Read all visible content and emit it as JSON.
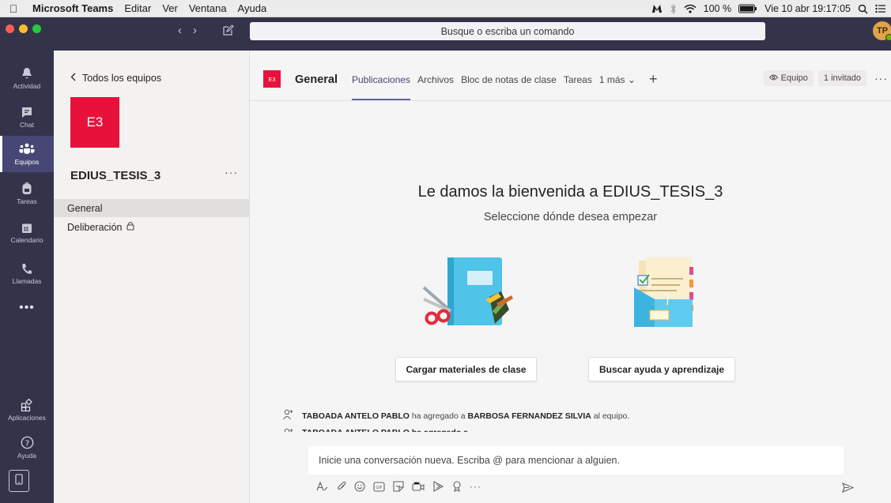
{
  "menubar": {
    "app_name": "Microsoft Teams",
    "menus": [
      "Editar",
      "Ver",
      "Ventana",
      "Ayuda"
    ],
    "battery": "100 %",
    "datetime": "Vie 10 abr  19:17:05"
  },
  "titlebar": {
    "search_placeholder": "Busque o escriba un comando",
    "avatar_initials": "TP"
  },
  "rail": {
    "items": [
      {
        "label": "Actividad",
        "icon": "bell-icon"
      },
      {
        "label": "Chat",
        "icon": "chat-icon"
      },
      {
        "label": "Equipos",
        "icon": "teams-icon",
        "active": true
      },
      {
        "label": "Tareas",
        "icon": "backpack-icon"
      },
      {
        "label": "Calendario",
        "icon": "calendar-icon"
      },
      {
        "label": "Llamadas",
        "icon": "phone-icon"
      }
    ],
    "more": "•••",
    "apps_label": "Aplicaciones",
    "help_label": "Ayuda"
  },
  "team": {
    "back_label": "Todos los equipos",
    "tile_text": "E3",
    "name": "EDIUS_TESIS_3",
    "more": "···",
    "channels": [
      {
        "label": "General",
        "selected": true
      },
      {
        "label": "Deliberación",
        "private": true
      }
    ]
  },
  "channel": {
    "tile_text": "E3",
    "title": "General",
    "tabs": [
      "Publicaciones",
      "Archivos",
      "Bloc de notas de clase",
      "Tareas",
      "1 más"
    ],
    "active_tab": "Publicaciones",
    "team_button": "Equipo",
    "guests": "1 invitado",
    "more": "···"
  },
  "welcome": {
    "heading": "Le damos la bienvenida a EDIUS_TESIS_3",
    "subheading": "Seleccione dónde desea empezar",
    "upload_button": "Cargar materiales de clase",
    "help_button": "Buscar ayuda y aprendizaje"
  },
  "activity": {
    "actor": "TABOADA ANTELO PABLO",
    "verb": "ha agregado a",
    "target": "BARBOSA FERNANDEZ SILVIA",
    "suffix": "al equipo.",
    "partial_line": "TABOADA ANTELO PABLO ha agregado a ..."
  },
  "composer": {
    "placeholder": "Inicie una conversación nueva. Escriba @ para mencionar a alguien.",
    "more": "···"
  },
  "colors": {
    "rail": "#33344a",
    "accent": "#6264a7",
    "team_tile": "#e8113b"
  }
}
